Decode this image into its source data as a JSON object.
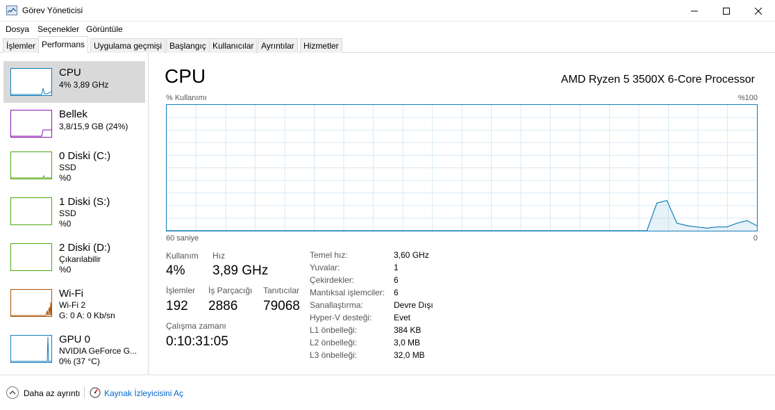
{
  "window": {
    "title": "Görev Yöneticisi",
    "icon": "task-manager-icon"
  },
  "menu": [
    "Dosya",
    "Seçenekler",
    "Görüntüle"
  ],
  "tabs": [
    "İşlemler",
    "Performans",
    "Uygulama geçmişi",
    "Başlangıç",
    "Kullanıcılar",
    "Ayrıntılar",
    "Hizmetler"
  ],
  "active_tab": "Performans",
  "sidebar": {
    "items": [
      {
        "name": "CPU",
        "line1": "4% 3,89 GHz",
        "line2": "",
        "color": "#117dbb",
        "selected": true
      },
      {
        "name": "Bellek",
        "line1": "3,8/15,9 GB (24%)",
        "line2": "",
        "color": "#8b12ae"
      },
      {
        "name": "0 Diski (C:)",
        "line1": "SSD",
        "line2": "%0",
        "color": "#4da60c"
      },
      {
        "name": "1 Diski (S:)",
        "line1": "SSD",
        "line2": "%0",
        "color": "#4da60c"
      },
      {
        "name": "2 Diski (D:)",
        "line1": "Çıkarılabilir",
        "line2": "%0",
        "color": "#4da60c"
      },
      {
        "name": "Wi-Fi",
        "line1": "Wi-Fi 2",
        "line2": "G: 0 A: 0 Kb/sn",
        "color": "#a74f01"
      },
      {
        "name": "GPU 0",
        "line1": "NVIDIA GeForce G...",
        "line2": "0% (37 °C)",
        "color": "#117dbb"
      }
    ]
  },
  "main": {
    "title": "CPU",
    "processor": "AMD Ryzen 5 3500X 6-Core Processor",
    "graph_label_left": "% Kullanımı",
    "graph_label_right": "%100",
    "time_label": "60 saniye",
    "time_zero": "0",
    "graph_color": "#117dbb",
    "usage_history_percent": [
      0,
      0,
      0,
      0,
      0,
      0,
      0,
      0,
      0,
      0,
      0,
      0,
      0,
      0,
      0,
      0,
      0,
      0,
      0,
      0,
      0,
      0,
      0,
      0,
      0,
      0,
      0,
      0,
      0,
      0,
      0,
      0,
      0,
      0,
      0,
      0,
      0,
      0,
      0,
      0,
      0,
      0,
      0,
      0,
      0,
      0,
      0,
      0,
      0,
      22,
      24,
      6,
      4,
      3,
      2,
      3,
      3,
      6,
      8,
      4
    ],
    "stats": {
      "kullanim_label": "Kullanım",
      "kullanim_value": "4%",
      "hiz_label": "Hız",
      "hiz_value": "3,89 GHz",
      "islemler_label": "İşlemler",
      "islemler_value": "192",
      "is_parcacigi_label": "İş Parçacığı",
      "is_parcacigi_value": "2886",
      "tanitici_label": "Tanıtıcılar",
      "tanitici_value": "79068",
      "calisma_label": "Çalışma zamanı",
      "calisma_value": "0:10:31:05"
    },
    "specs": [
      {
        "label": "Temel hız:",
        "value": "3,60 GHz"
      },
      {
        "label": "Yuvalar:",
        "value": "1"
      },
      {
        "label": "Çekirdekler:",
        "value": "6"
      },
      {
        "label": "Mantıksal işlemciler:",
        "value": "6"
      },
      {
        "label": "Sanallaştırma:",
        "value": "Devre Dışı"
      },
      {
        "label": "Hyper-V desteği:",
        "value": "Evet"
      },
      {
        "label": "L1 önbelleği:",
        "value": "384 KB"
      },
      {
        "label": "L2 önbelleği:",
        "value": "3,0 MB"
      },
      {
        "label": "L3 önbelleği:",
        "value": "32,0 MB"
      }
    ]
  },
  "footer": {
    "less_details": "Daha az ayrıntı",
    "resource_monitor": "Kaynak İzleyicisini Aç"
  }
}
